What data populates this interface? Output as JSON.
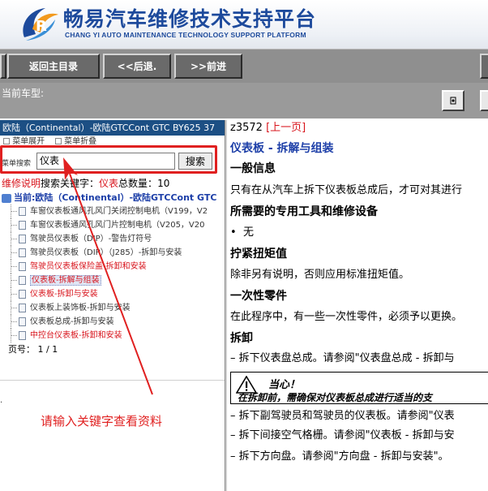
{
  "header": {
    "title": "畅易汽车维修技术支持平台",
    "subtitle": "CHANG YI AUTO MAINTENANCE TECHNOLOGY SUPPORT PLATFORM"
  },
  "toolbar": {
    "home_label": "返回主目录",
    "back_label": "<<后退.",
    "forward_label": ">>前进"
  },
  "carbar": {
    "label": "当前车型:"
  },
  "left": {
    "title": "欧陆（Continental）-欧陆GTCCont GTC BY625 37",
    "opt_expand": "菜单展开",
    "opt_collapse": "菜单折叠",
    "search_label": "菜单搜索",
    "search_value": "仪表",
    "search_button": "搜索",
    "result_prefix": "维修说明",
    "result_keyword_label": "搜索关键字：",
    "result_keyword": "仪表",
    "result_total_label": "总数量：",
    "result_total": "10",
    "root_label": "当前:欧陆（Continental）-欧陆GTCCont GTC",
    "items": [
      {
        "label": "车窗仪表板通风孔风门关闭控制电机（V199，V2"
      },
      {
        "label": "车窗仪表板通风孔风门片控制电机（V205，V20"
      },
      {
        "label": "驾驶员仪表板（DIP）-警告灯符号"
      },
      {
        "label": "驾驶员仪表板（DIP）（J285）-拆卸与安装"
      },
      {
        "label": "驾驶员仪表板保险盖-拆卸和安装"
      },
      {
        "label": "仪表板-拆解与组装"
      },
      {
        "label": "仪表板-拆卸与安装"
      },
      {
        "label": "仪表板上装饰板-拆卸与安装"
      },
      {
        "label": "仪表板总成-拆卸与安装"
      },
      {
        "label": "中控台仪表板-拆卸和安装"
      }
    ],
    "pager_label": "页号：",
    "pager_value": "1 / 1",
    "hint": "请输入关键字查看资料"
  },
  "right": {
    "doc_id": "z3572",
    "prev_link": "[上一页]",
    "title": "仪表板 - 拆解与组装",
    "s1": "一般信息",
    "p1": "只有在从汽车上拆下仪表板总成后，才可对其进行",
    "s2": "所需要的专用工具和维修设备",
    "bullet1": "无",
    "s3": "拧紧扭矩值",
    "p3": "除非另有说明，否则应用标准扭矩值。",
    "s4": "一次性零件",
    "p4": "在此程序中，有一些一次性零件，必须予以更换。",
    "s5": "拆卸",
    "step1": "– 拆下仪表盘总成。请参阅\"仪表盘总成 - 拆卸与",
    "caution_title": "当心！",
    "caution_text": "在拆卸前，需确保对仪表板总成进行适当的支",
    "step2": "– 拆下副驾驶员和驾驶员的仪表板。请参阅\"仪表",
    "step3": "– 拆下间接空气格栅。请参阅\"仪表板 - 拆卸与安",
    "step4": "– 拆下方向盘。请参阅\"方向盘 - 拆卸与安装\"。"
  },
  "colors": {
    "brand_blue": "#1d4a9c",
    "title_bar": "#1c4f84",
    "accent_red": "#d8141c",
    "toolbar_gray": "#8f8f8f"
  }
}
